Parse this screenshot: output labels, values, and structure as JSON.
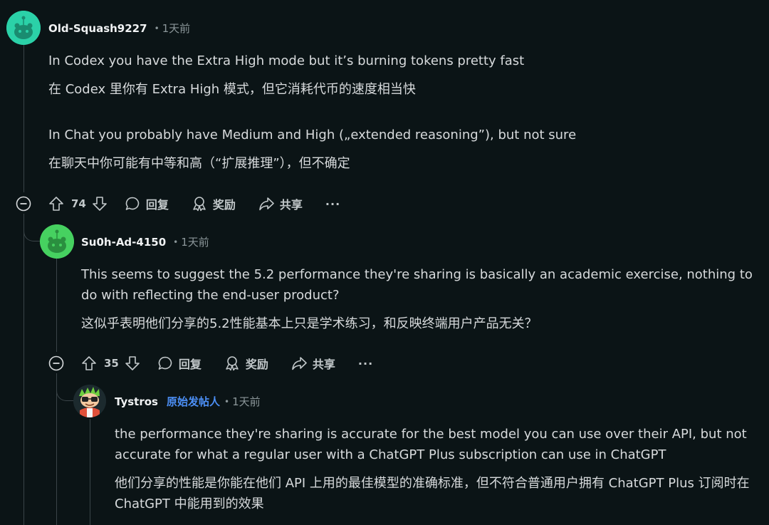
{
  "comments": [
    {
      "username": "Old-Squash9227",
      "separator": "•",
      "time": "1天前",
      "paragraphs": [
        "In Codex you have the Extra High mode but it’s burning tokens pretty fast",
        "在 Codex 里你有 Extra High 模式，但它消耗代币的速度相当快",
        "In Chat you probably have Medium and High („extended reasoning”), but not sure",
        "在聊天中你可能有中等和高（“扩展推理”），但不确定"
      ],
      "votes": "74",
      "reply_label": "回复",
      "award_label": "奖励",
      "share_label": "共享",
      "more_label": "···"
    },
    {
      "username": "Su0h-Ad-4150",
      "separator": "•",
      "time": "1天前",
      "paragraphs": [
        "This seems to suggest the 5.2 performance they're sharing is basically an academic exercise, nothing to do with reflecting the end-user product?",
        "这似乎表明他们分享的5.2性能基本上只是学术练习，和反映终端用户产品无关？"
      ],
      "votes": "35",
      "reply_label": "回复",
      "award_label": "奖励",
      "share_label": "共享",
      "more_label": "···"
    },
    {
      "username": "Tystros",
      "op_badge": "原始发帖人",
      "separator": "•",
      "time": "1天前",
      "paragraphs": [
        "the performance they're sharing is accurate for the best model you can use over their API, but not accurate for what a regular user with a ChatGPT Plus subscription can use in ChatGPT",
        "他们分享的性能是你能在他们 API 上用的最佳模型的准确标准，但不符合普通用户拥有 ChatGPT Plus 订阅时在 ChatGPT 中能用到的效果"
      ]
    }
  ],
  "colors": {
    "background": "#0b1416",
    "avatar_teal": "#2bd1a8",
    "avatar_green": "#46d160",
    "op_badge": "#4c8ff5"
  }
}
